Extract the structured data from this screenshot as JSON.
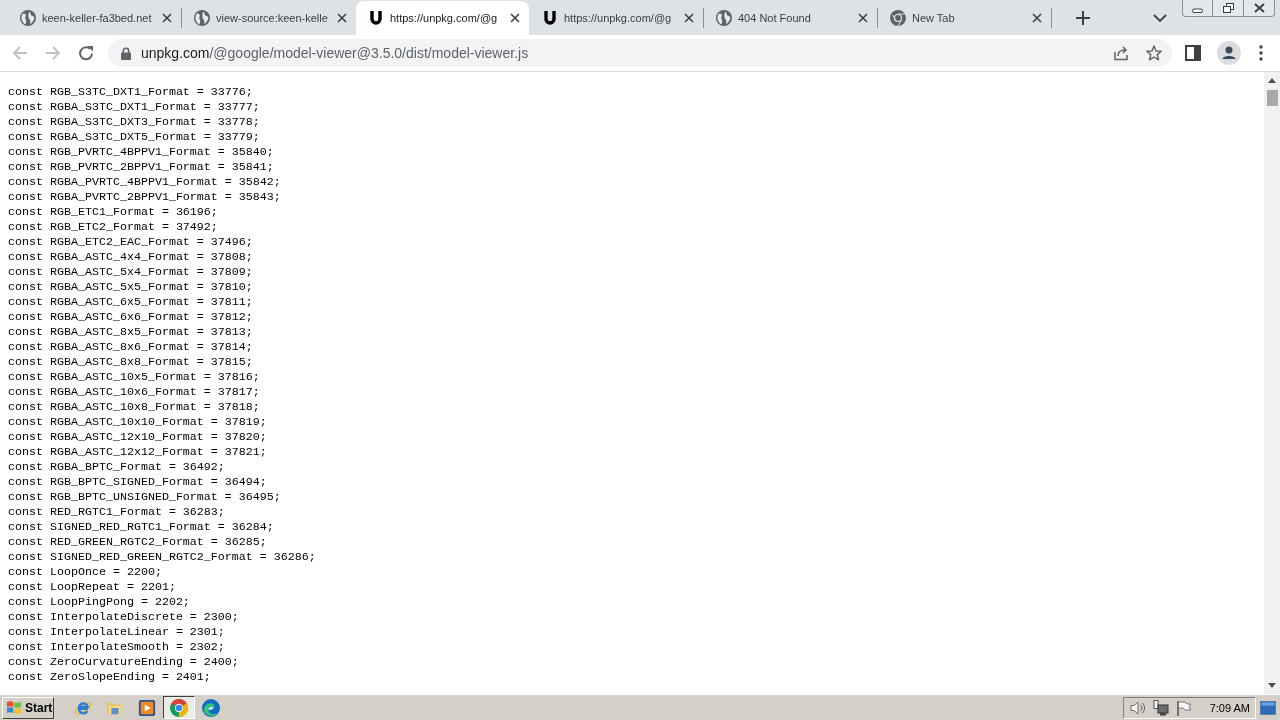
{
  "tabs": [
    {
      "title": "keen-keller-fa3bed.net",
      "kind": "globe",
      "selected": false
    },
    {
      "title": "view-source:keen-kelle",
      "kind": "globe",
      "selected": false
    },
    {
      "title": "https://unpkg.com/@g",
      "kind": "unpkg",
      "selected": true
    },
    {
      "title": "https://unpkg.com/@g",
      "kind": "unpkg",
      "selected": false
    },
    {
      "title": "404 Not Found",
      "kind": "globe",
      "selected": false
    },
    {
      "title": "New Tab",
      "kind": "chrome",
      "selected": false
    }
  ],
  "toolbar": {
    "nav": [
      {
        "kind": "back",
        "disabled": true
      },
      {
        "kind": "forward",
        "disabled": true
      },
      {
        "kind": "reload",
        "disabled": false
      }
    ],
    "address": {
      "host": "unpkg.com",
      "path": "/@google/model-viewer@3.5.0/dist/model-viewer.js"
    }
  },
  "code_lines": [
    "const RGB_S3TC_DXT1_Format = 33776;",
    "const RGBA_S3TC_DXT1_Format = 33777;",
    "const RGBA_S3TC_DXT3_Format = 33778;",
    "const RGBA_S3TC_DXT5_Format = 33779;",
    "const RGB_PVRTC_4BPPV1_Format = 35840;",
    "const RGB_PVRTC_2BPPV1_Format = 35841;",
    "const RGBA_PVRTC_4BPPV1_Format = 35842;",
    "const RGBA_PVRTC_2BPPV1_Format = 35843;",
    "const RGB_ETC1_Format = 36196;",
    "const RGB_ETC2_Format = 37492;",
    "const RGBA_ETC2_EAC_Format = 37496;",
    "const RGBA_ASTC_4x4_Format = 37808;",
    "const RGBA_ASTC_5x4_Format = 37809;",
    "const RGBA_ASTC_5x5_Format = 37810;",
    "const RGBA_ASTC_6x5_Format = 37811;",
    "const RGBA_ASTC_6x6_Format = 37812;",
    "const RGBA_ASTC_8x5_Format = 37813;",
    "const RGBA_ASTC_8x6_Format = 37814;",
    "const RGBA_ASTC_8x8_Format = 37815;",
    "const RGBA_ASTC_10x5_Format = 37816;",
    "const RGBA_ASTC_10x6_Format = 37817;",
    "const RGBA_ASTC_10x8_Format = 37818;",
    "const RGBA_ASTC_10x10_Format = 37819;",
    "const RGBA_ASTC_12x10_Format = 37820;",
    "const RGBA_ASTC_12x12_Format = 37821;",
    "const RGBA_BPTC_Format = 36492;",
    "const RGB_BPTC_SIGNED_Format = 36494;",
    "const RGB_BPTC_UNSIGNED_Format = 36495;",
    "const RED_RGTC1_Format = 36283;",
    "const SIGNED_RED_RGTC1_Format = 36284;",
    "const RED_GREEN_RGTC2_Format = 36285;",
    "const SIGNED_RED_GREEN_RGTC2_Format = 36286;",
    "const LoopOnce = 2200;",
    "const LoopRepeat = 2201;",
    "const LoopPingPong = 2202;",
    "const InterpolateDiscrete = 2300;",
    "const InterpolateLinear = 2301;",
    "const InterpolateSmooth = 2302;",
    "const ZeroCurvatureEnding = 2400;",
    "const ZeroSlopeEnding = 2401;"
  ],
  "taskbar": {
    "start": "Start",
    "apps": [
      {
        "kind": "ie",
        "active": false
      },
      {
        "kind": "folder",
        "active": false
      },
      {
        "kind": "media",
        "active": false
      },
      {
        "kind": "chrome",
        "active": true
      },
      {
        "kind": "edge",
        "active": false
      }
    ],
    "clock": "7:09 AM"
  }
}
